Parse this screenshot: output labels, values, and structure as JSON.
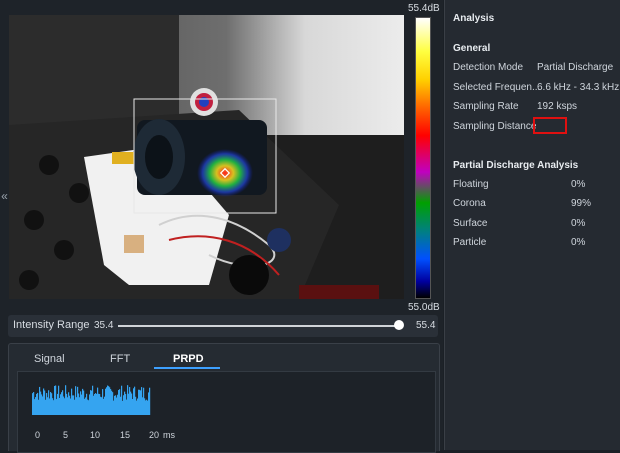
{
  "camera": {
    "scale_max": "55.4dB",
    "scale_min": "55.0dB"
  },
  "intensity": {
    "label": "Intensity Range",
    "min": "35.4",
    "max": "55.4",
    "slider_level_percent": 100
  },
  "tabs": [
    {
      "label": "Signal",
      "active": false
    },
    {
      "label": "FFT",
      "active": false
    },
    {
      "label": "PRPD",
      "active": true
    }
  ],
  "plot": {
    "x_ticks": [
      "0",
      "5",
      "10",
      "15",
      "20"
    ],
    "x_unit": "ms"
  },
  "analysis": {
    "title": "Analysis",
    "general_title": "General",
    "general": [
      {
        "key": "Detection Mode",
        "value": "Partial Discharge"
      },
      {
        "key": "Selected Frequen...",
        "value": "6.6 kHz - 34.3 kHz"
      },
      {
        "key": "Sampling Rate",
        "value": "192 ksps"
      },
      {
        "key": "Sampling Distance",
        "value": ""
      }
    ],
    "pd_title": "Partial Discharge Analysis",
    "pd": [
      {
        "key": "Floating",
        "value": "0%"
      },
      {
        "key": "Corona",
        "value": "99%"
      },
      {
        "key": "Surface",
        "value": "0%"
      },
      {
        "key": "Particle",
        "value": "0%"
      }
    ]
  },
  "colors": {
    "accent": "#3da0ff",
    "highlight_box": "#e01010",
    "plot_bars": "#35a4f0"
  }
}
